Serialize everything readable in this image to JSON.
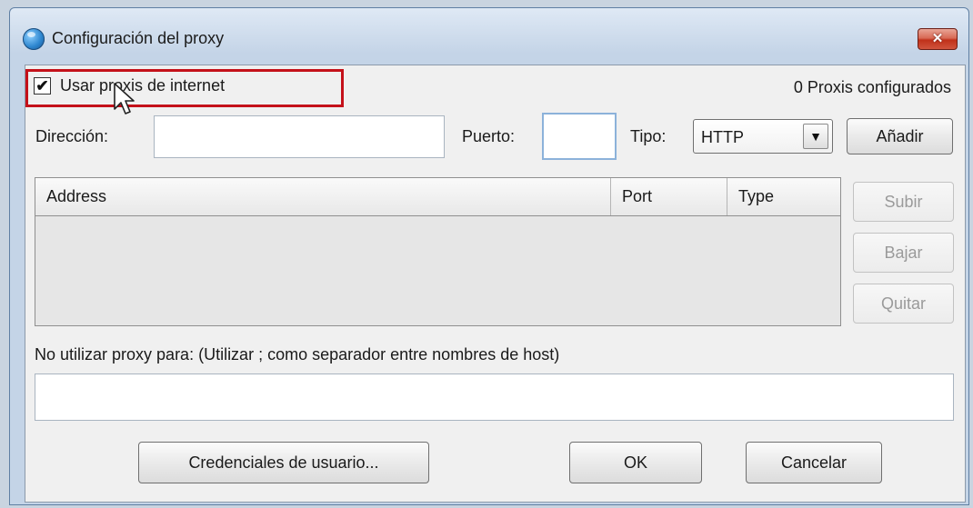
{
  "window": {
    "title": "Configuración del proxy",
    "close_glyph": "✕"
  },
  "use_proxies": {
    "label": "Usar proxis de internet",
    "checked": true,
    "check_glyph": "✔"
  },
  "status": {
    "configured": "0 Proxis configurados"
  },
  "form": {
    "address_label": "Dirección:",
    "address_value": "",
    "port_label": "Puerto:",
    "port_value": "",
    "type_label": "Tipo:",
    "type_selected": "HTTP",
    "add_button": "Añadir"
  },
  "table": {
    "columns": [
      "Address",
      "Port",
      "Type"
    ],
    "rows": []
  },
  "side_buttons": {
    "up": "Subir",
    "down": "Bajar",
    "remove": "Quitar"
  },
  "no_proxy": {
    "label": "No utilizar proxy para: (Utilizar ; como separador entre nombres de host)",
    "value": ""
  },
  "footer": {
    "credentials_button": "Credenciales de usuario...",
    "ok_button": "OK",
    "cancel_button": "Cancelar"
  },
  "colors": {
    "highlight": "#c4111a",
    "close_button": "#c0311a",
    "title_gradient": "#dfe9f5"
  },
  "icons": {
    "app": "globe-icon",
    "close": "close-icon",
    "dropdown": "chevron-down-icon",
    "cursor": "mouse-pointer-icon"
  }
}
